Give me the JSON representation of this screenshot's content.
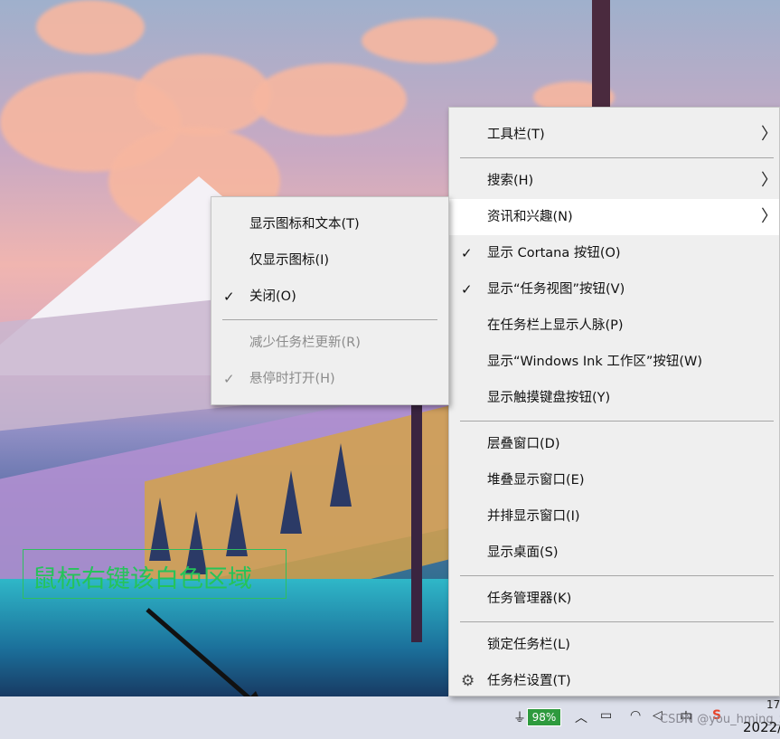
{
  "context_menu": {
    "items": [
      {
        "label": "工具栏(T)",
        "has_submenu": true
      },
      {
        "label": "搜索(H)",
        "has_submenu": true
      },
      {
        "label": "资讯和兴趣(N)",
        "has_submenu": true,
        "highlighted": true
      },
      {
        "label": "显示 Cortana 按钮(O)",
        "checked": true
      },
      {
        "label": "显示“任务视图”按钮(V)",
        "checked": true
      },
      {
        "label": "在任务栏上显示人脉(P)"
      },
      {
        "label": "显示“Windows Ink 工作区”按钮(W)"
      },
      {
        "label": "显示触摸键盘按钮(Y)"
      },
      {
        "label": "层叠窗口(D)"
      },
      {
        "label": "堆叠显示窗口(E)"
      },
      {
        "label": "并排显示窗口(I)"
      },
      {
        "label": "显示桌面(S)"
      },
      {
        "label": "任务管理器(K)"
      },
      {
        "label": "锁定任务栏(L)"
      },
      {
        "label": "任务栏设置(T)",
        "icon": "gear-icon"
      }
    ]
  },
  "submenu": {
    "items": [
      {
        "label": "显示图标和文本(T)"
      },
      {
        "label": "仅显示图标(I)"
      },
      {
        "label": "关闭(O)",
        "checked": true
      },
      {
        "label": "减少任务栏更新(R)",
        "disabled": true
      },
      {
        "label": "悬停时打开(H)",
        "checked": true,
        "disabled": true
      }
    ]
  },
  "annotation": {
    "text": "鼠标右键该白色区域",
    "color": "#25c35a"
  },
  "taskbar": {
    "battery_percent": "98%",
    "watermark": "CSDN @you_hming_zi",
    "clock_partial": "2022/",
    "clock_partial_top": "17"
  },
  "glyphs": {
    "check": "✓",
    "chevron": "〉",
    "gear": "⚙"
  }
}
